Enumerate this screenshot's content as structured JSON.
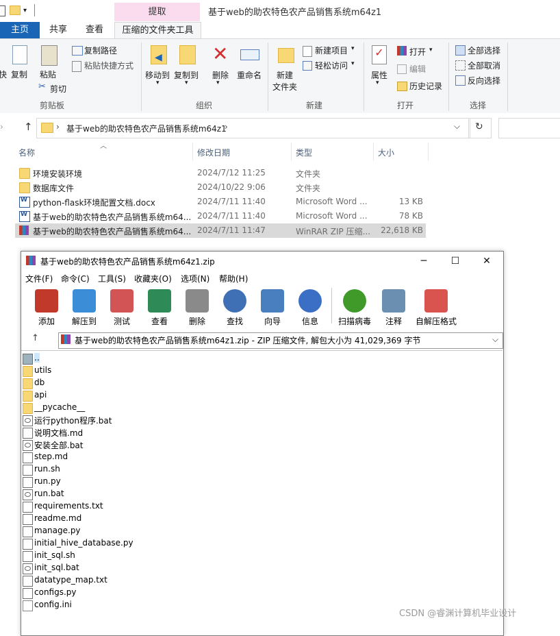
{
  "explorer": {
    "window_title": "基于web的助农特色农产品销售系统m64z1",
    "context_tab": "提取",
    "tabs": [
      "主页",
      "共享",
      "查看",
      "压缩的文件夹工具"
    ],
    "ribbon": {
      "clipboard": {
        "label": "剪贴板",
        "cut_partial": "快",
        "copy": "复制",
        "paste": "粘贴",
        "copy_path": "复制路径",
        "paste_shortcut": "粘贴快捷方式",
        "cut": "剪切"
      },
      "organize": {
        "label": "组织",
        "move_to": "移动到",
        "copy_to": "复制到",
        "delete": "删除",
        "rename": "重命名"
      },
      "new": {
        "label": "新建",
        "new_item": "新建项目",
        "easy_access": "轻松访问",
        "new_folder": "新建\n文件夹"
      },
      "open": {
        "label": "打开",
        "properties": "属性",
        "open": "打开",
        "edit": "编辑",
        "history": "历史记录"
      },
      "select": {
        "label": "选择",
        "select_all": "全部选择",
        "select_none": "全部取消",
        "invert": "反向选择"
      }
    },
    "address": {
      "path_segment": "基于web的助农特色农产品销售系统m64z1",
      "separator": "›"
    },
    "columns": {
      "name": "名称",
      "date": "修改日期",
      "type": "类型",
      "size": "大小"
    },
    "files": [
      {
        "name": "环境安装环境",
        "date": "2024/7/12 11:25",
        "type": "文件夹",
        "size": "",
        "icon": "folder"
      },
      {
        "name": "数据库文件",
        "date": "2024/10/22 9:06",
        "type": "文件夹",
        "size": "",
        "icon": "folder"
      },
      {
        "name": "python-flask环境配置文档.docx",
        "date": "2024/7/11 11:40",
        "type": "Microsoft Word ...",
        "size": "13 KB",
        "icon": "word"
      },
      {
        "name": "基于web的助农特色农产品销售系统m64...",
        "date": "2024/7/11 11:40",
        "type": "Microsoft Word ...",
        "size": "78 KB",
        "icon": "word"
      },
      {
        "name": "基于web的助农特色农产品销售系统m64...",
        "date": "2024/7/11 11:47",
        "type": "WinRAR ZIP 压缩...",
        "size": "22,618 KB",
        "icon": "rar",
        "selected": true
      }
    ]
  },
  "winrar": {
    "title": "基于web的助农特色农产品销售系统m64z1.zip",
    "window_buttons": {
      "minimize": "─",
      "maximize": "☐",
      "close": "✕"
    },
    "menu": [
      "文件(F)",
      "命令(C)",
      "工具(S)",
      "收藏夹(O)",
      "选项(N)",
      "帮助(H)"
    ],
    "toolbar": [
      "添加",
      "解压到",
      "测试",
      "查看",
      "删除",
      "查找",
      "向导",
      "信息",
      "扫描病毒",
      "注释",
      "自解压格式"
    ],
    "toolbar_colors": [
      "#c0392b",
      "#3c8dd8",
      "#d35454",
      "#2e8b57",
      "#8a8a8a",
      "#3f6fb5",
      "#4a7fbf",
      "#3b6ec5",
      "#3f9a2a",
      "#6a8fb0",
      "#d9534f"
    ],
    "path_text": "基于web的助农特色农产品销售系统m64z1.zip - ZIP 压缩文件, 解包大小为 41,029,369 字节",
    "entries": [
      {
        "name": "..",
        "icon": "parent"
      },
      {
        "name": "utils",
        "icon": "folder"
      },
      {
        "name": "db",
        "icon": "folder"
      },
      {
        "name": "api",
        "icon": "folder"
      },
      {
        "name": "__pycache__",
        "icon": "folder"
      },
      {
        "name": "运行python程序.bat",
        "icon": "bat"
      },
      {
        "name": "说明文档.md",
        "icon": "file"
      },
      {
        "name": "安装全部.bat",
        "icon": "bat"
      },
      {
        "name": "step.md",
        "icon": "file"
      },
      {
        "name": "run.sh",
        "icon": "file"
      },
      {
        "name": "run.py",
        "icon": "file"
      },
      {
        "name": "run.bat",
        "icon": "bat"
      },
      {
        "name": "requirements.txt",
        "icon": "file"
      },
      {
        "name": "readme.md",
        "icon": "file"
      },
      {
        "name": "manage.py",
        "icon": "file"
      },
      {
        "name": "initial_hive_database.py",
        "icon": "file"
      },
      {
        "name": "init_sql.sh",
        "icon": "file"
      },
      {
        "name": "init_sql.bat",
        "icon": "bat"
      },
      {
        "name": "datatype_map.txt",
        "icon": "file"
      },
      {
        "name": "configs.py",
        "icon": "file"
      },
      {
        "name": "config.ini",
        "icon": "cfg"
      }
    ]
  },
  "watermark": "CSDN @睿渊计算机毕业设计",
  "colors": {
    "accent": "#1a65b5",
    "context_tab": "#fadcee",
    "selected_row": "#d9d9d9"
  }
}
